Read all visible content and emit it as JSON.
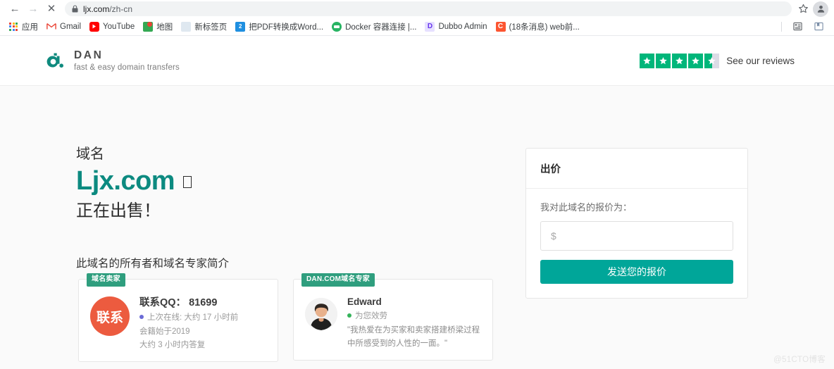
{
  "browser": {
    "back_icon": "back-arrow-icon",
    "forward_icon": "forward-arrow-icon",
    "stop_icon": "stop-loading-icon",
    "lock_icon": "lock-icon",
    "url_host": "ljx.com",
    "url_path": "/zh-cn",
    "star_icon": "star-icon",
    "profile_icon": "profile-avatar-icon",
    "bookmarks": [
      {
        "label": "应用",
        "icon": "apps-grid-icon"
      },
      {
        "label": "Gmail",
        "icon": "gmail-icon"
      },
      {
        "label": "YouTube",
        "icon": "youtube-icon"
      },
      {
        "label": "地图",
        "icon": "maps-icon"
      },
      {
        "label": "新标签页",
        "icon": "new-tab-icon"
      },
      {
        "label": "把PDF转换成Word...",
        "icon": "pdf-to-word-icon"
      },
      {
        "label": "Docker 容器连接 |...",
        "icon": "docker-icon"
      },
      {
        "label": "Dubbo Admin",
        "icon": "dubbo-icon"
      },
      {
        "label": "(18条消息) web前...",
        "icon": "csdn-icon"
      }
    ],
    "reading_list_icon": "reading-list-icon",
    "other_bookmarks_icon": "other-bookmarks-icon"
  },
  "site": {
    "brand_name": "DAN",
    "brand_tagline": "fast & easy domain transfers",
    "brand_logo_icon": "dan-logo-icon",
    "reviews_label": "See our reviews",
    "stars_filled": 4,
    "stars_total": 5,
    "star_color": "#00b67a"
  },
  "hero": {
    "kicker": "域名",
    "domain": "Ljx.com",
    "missing_glyph": "□",
    "for_sale": "正在出售！",
    "domain_color": "#0c8a80"
  },
  "people": {
    "section_title": "此域名的所有者和域名专家简介",
    "seller": {
      "badge": "域名卖家",
      "avatar_text": "联系",
      "avatar_color": "#ec5b3f",
      "name": "联系QQ： 81699",
      "status": "上次在线: 大约 17 小时前",
      "status_dot_color": "#6b6bd6",
      "member_since": "会籍始于2019",
      "response_time": "大约 3 小时内答复"
    },
    "expert": {
      "badge": "DAN.COM域名专家",
      "avatar_icon": "expert-photo-avatar",
      "name": "Edward",
      "status": "为您效劳",
      "status_dot_color": "#35b35b",
      "quote": "\"我热爱在为买家和卖家搭建桥梁过程中所感受到的人性的一面。\""
    }
  },
  "bid": {
    "title": "出价",
    "label": "我对此域名的报价为：",
    "input_value": "",
    "input_placeholder": "$",
    "submit_label": "发送您的报价",
    "accent_color": "#00a699"
  },
  "watermark": "@51CTO博客"
}
